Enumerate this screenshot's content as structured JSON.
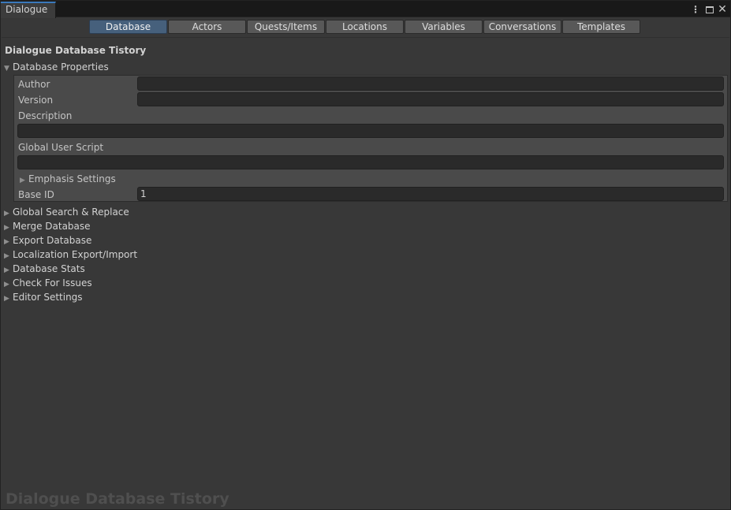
{
  "window": {
    "tab_title": "Dialogue"
  },
  "toolbar": {
    "tabs": [
      "Database",
      "Actors",
      "Quests/Items",
      "Locations",
      "Variables",
      "Conversations",
      "Templates"
    ],
    "active_tab": "Database"
  },
  "header": {
    "title": "Dialogue Database Tistory"
  },
  "database_properties": {
    "label": "Database Properties",
    "expanded": true,
    "fields": {
      "author_label": "Author",
      "author_value": "",
      "version_label": "Version",
      "version_value": "",
      "description_label": "Description",
      "description_value": "",
      "global_user_script_label": "Global User Script",
      "global_user_script_value": "",
      "emphasis_settings_label": "Emphasis Settings",
      "base_id_label": "Base ID",
      "base_id_value": "1"
    }
  },
  "sections": [
    "Global Search & Replace",
    "Merge Database",
    "Export Database",
    "Localization Export/Import",
    "Database Stats",
    "Check For Issues",
    "Editor Settings"
  ],
  "watermark": "Dialogue Database Tistory",
  "icons": {
    "more": "kebab-icon",
    "maximize": "maximize-icon",
    "close": "close-icon",
    "expanded": "triangle-down-icon",
    "collapsed": "triangle-right-icon"
  },
  "colors": {
    "background": "#383838",
    "active_tab": "#46607c",
    "tab": "#585858",
    "panel": "#4a4a4a",
    "field": "#2a2a2a"
  }
}
